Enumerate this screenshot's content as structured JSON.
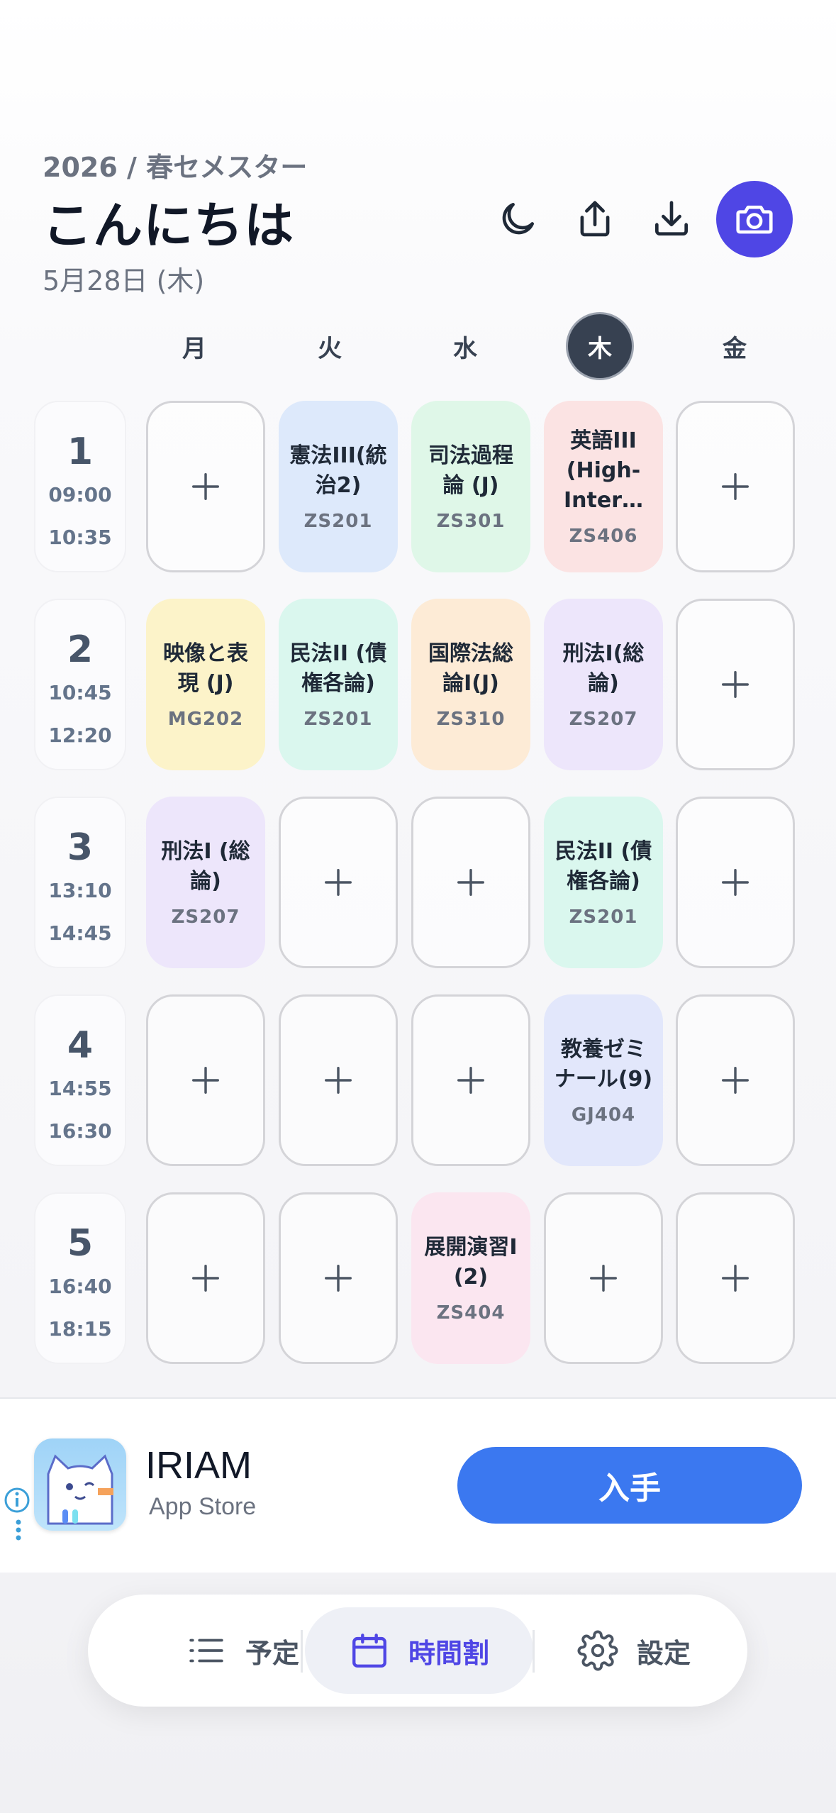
{
  "header": {
    "term": "2026 / 春セメスター",
    "greeting": "こんにちは",
    "date": "5月28日 (木)",
    "buttons": [
      "moon-icon",
      "share-icon",
      "download-icon",
      "camera-icon"
    ],
    "accent": "#4f46e5"
  },
  "days": [
    "月",
    "火",
    "水",
    "木",
    "金"
  ],
  "today_index": 3,
  "periods": [
    {
      "num": "1",
      "start": "09:00",
      "end": "10:35"
    },
    {
      "num": "2",
      "start": "10:45",
      "end": "12:20"
    },
    {
      "num": "3",
      "start": "13:10",
      "end": "14:45"
    },
    {
      "num": "4",
      "start": "14:55",
      "end": "16:30"
    },
    {
      "num": "5",
      "start": "16:40",
      "end": "18:15"
    }
  ],
  "timetable": {
    "p1": {
      "tue": {
        "name": "憲法III(統治2)",
        "room": "ZS201",
        "color": "#dde9fb"
      },
      "wed": {
        "name": "司法過程論 (J)",
        "room": "ZS301",
        "color": "#dff7e8"
      },
      "thu": {
        "name": "英語III (High-Inter…",
        "room": "ZS406",
        "color": "#fbe3e3"
      }
    },
    "p2": {
      "mon": {
        "name": "映像と表現 (J)",
        "room": "MG202",
        "color": "#fcf3c9"
      },
      "tue": {
        "name": "民法II (債権各論)",
        "room": "ZS201",
        "color": "#daf7ee"
      },
      "wed": {
        "name": "国際法総論I(J)",
        "room": "ZS310",
        "color": "#fdebd6"
      },
      "thu": {
        "name": "刑法I(総論)",
        "room": "ZS207",
        "color": "#ede6fb"
      }
    },
    "p3": {
      "mon": {
        "name": "刑法I (総論)",
        "room": "ZS207",
        "color": "#ede6fb"
      },
      "thu": {
        "name": "民法II (債権各論)",
        "room": "ZS201",
        "color": "#daf7ee"
      }
    },
    "p4": {
      "thu": {
        "name": "教養ゼミナール(9)",
        "room": "GJ404",
        "color": "#e2e7fb"
      }
    },
    "p5": {
      "wed": {
        "name": "展開演習I (2)",
        "room": "ZS404",
        "color": "#fbe6f0"
      }
    }
  },
  "ad": {
    "app_name": "IRIAM",
    "store": "App Store",
    "cta": "入手",
    "cta_color": "#3b78f0"
  },
  "tabbar": {
    "items": [
      {
        "label": "予定",
        "icon": "list-icon"
      },
      {
        "label": "時間割",
        "icon": "calendar-icon",
        "active": true
      },
      {
        "label": "設定",
        "icon": "gear-icon"
      }
    ]
  }
}
